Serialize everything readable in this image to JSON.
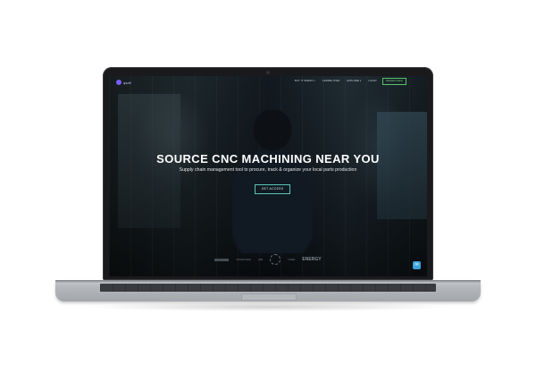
{
  "nav": {
    "logo_text": "qsoft",
    "items": [
      "BUY IT SMART ▾",
      "CAPABILITIES",
      "EXPLORE ▾",
      "LOGIN"
    ],
    "cta": "Schedule a Demo"
  },
  "hero": {
    "title": "SOURCE CNC MACHINING NEAR YOU",
    "subtitle": "Supply chain management tool to procure, track & organize your local parts production",
    "button": "GET ACCESS"
  },
  "partners": [
    "ADVANCED",
    "AMI",
    "CSEE",
    "ENERGY"
  ],
  "chat_icon": "chat-icon",
  "colors": {
    "accent": "#58c6b7",
    "cta_green": "#55c26b",
    "logo_purple": "#7b5cff",
    "chat_blue": "#3aa3d8"
  }
}
